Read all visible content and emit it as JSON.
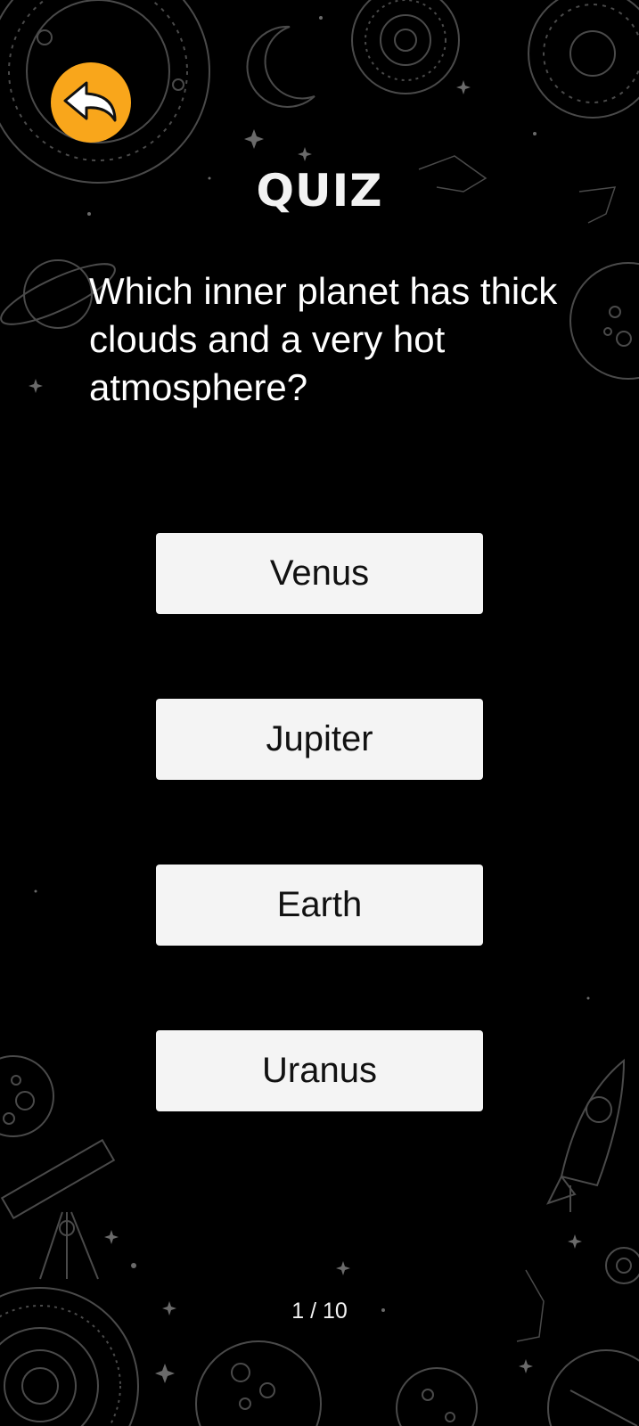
{
  "header": {
    "title": "QUIZ",
    "back_icon": "back-arrow-icon",
    "back_color": "#F9A61B"
  },
  "question": {
    "text": "Which inner planet has thick clouds and a very hot atmosphere?"
  },
  "answers": [
    {
      "label": "Venus"
    },
    {
      "label": "Jupiter"
    },
    {
      "label": "Earth"
    },
    {
      "label": "Uranus"
    }
  ],
  "progress": {
    "text": "1 / 10"
  },
  "theme": {
    "background": "#000000",
    "button_background": "#F4F4F4",
    "line_art": "#5a5a5a"
  }
}
